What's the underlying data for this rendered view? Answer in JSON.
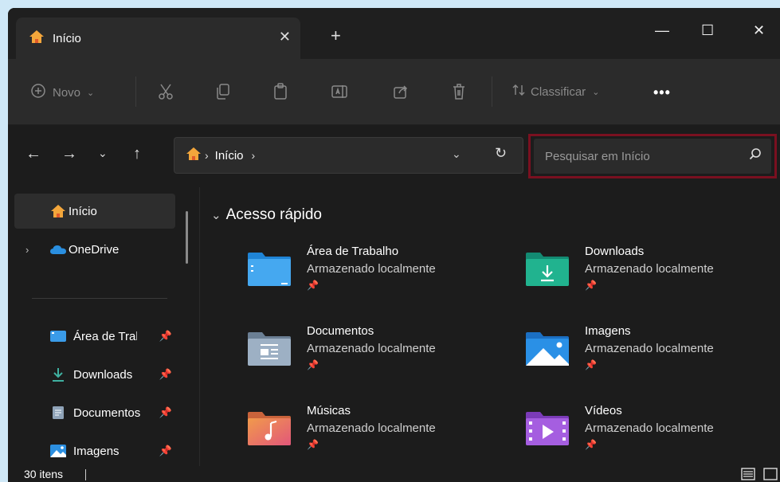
{
  "window": {
    "title": "Início"
  },
  "tab": {
    "label": "Início",
    "close": "✕",
    "new_tab": "+"
  },
  "window_controls": {
    "minimize": "—",
    "maximize": "☐",
    "close": "✕"
  },
  "toolbar": {
    "new_label": "Novo",
    "sort_label": "Classificar",
    "more": "•••"
  },
  "address_bar": {
    "segment": "Início",
    "separator": "›"
  },
  "search": {
    "placeholder": "Pesquisar em Início",
    "value": ""
  },
  "sidebar": {
    "items": [
      {
        "label": "Início",
        "icon": "home-icon"
      },
      {
        "label": "OneDrive",
        "icon": "cloud-icon"
      },
      {
        "label": "Área de Trabalho",
        "icon": "desktop-folder-icon"
      },
      {
        "label": "Downloads",
        "icon": "download-icon"
      },
      {
        "label": "Documentos",
        "icon": "documents-icon"
      },
      {
        "label": "Imagens",
        "icon": "pictures-icon"
      }
    ]
  },
  "main": {
    "section_title": "Acesso rápido",
    "items": [
      {
        "name": "Área de Trabalho",
        "sub": "Armazenado localmente"
      },
      {
        "name": "Downloads",
        "sub": "Armazenado localmente"
      },
      {
        "name": "Documentos",
        "sub": "Armazenado localmente"
      },
      {
        "name": "Imagens",
        "sub": "Armazenado localmente"
      },
      {
        "name": "Músicas",
        "sub": "Armazenado localmente"
      },
      {
        "name": "Vídeos",
        "sub": "Armazenado localmente"
      }
    ]
  },
  "status": {
    "count": "30 itens"
  },
  "colors": {
    "accent_highlight": "#7a1020",
    "background": "#1c1c1c"
  }
}
